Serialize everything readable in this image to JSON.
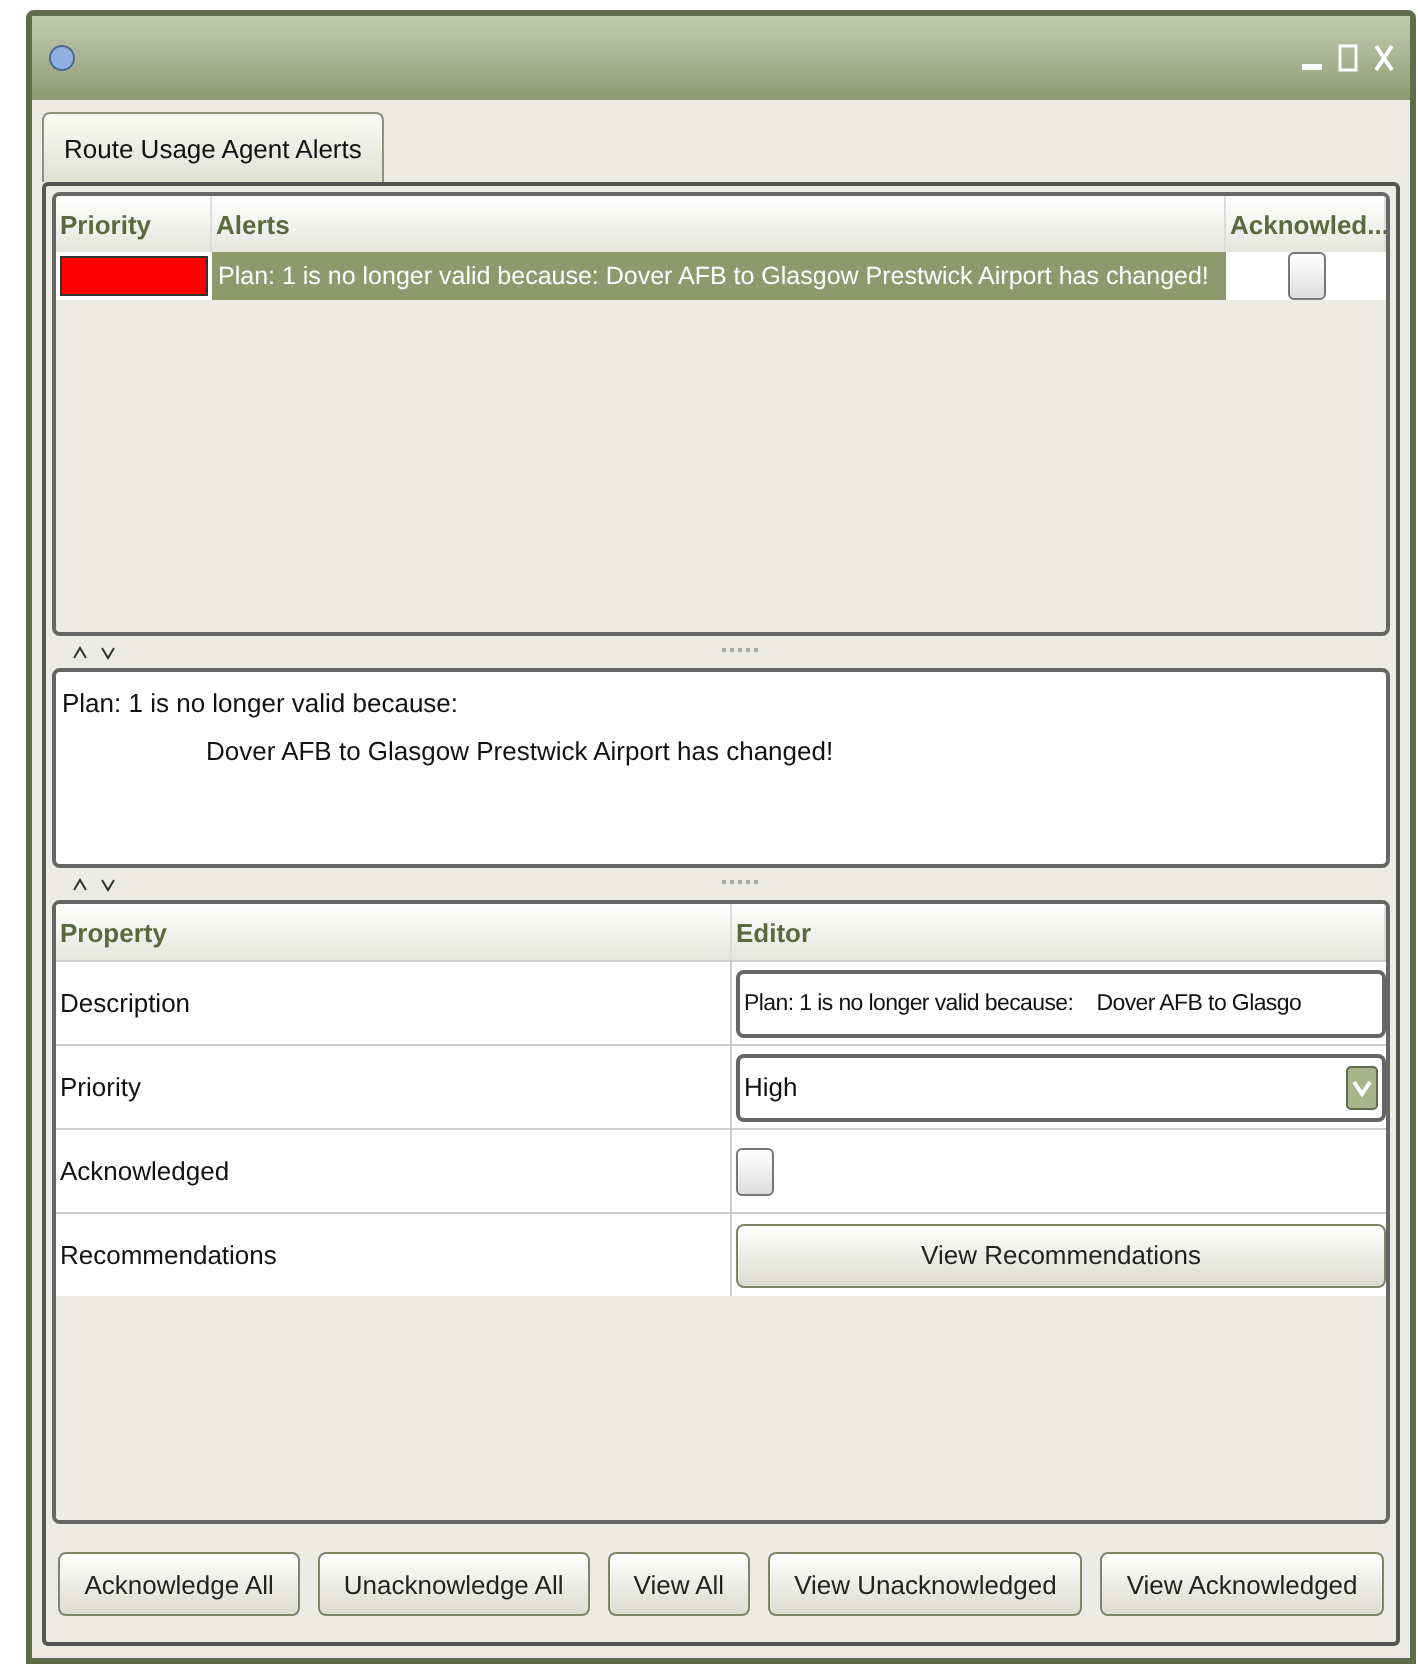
{
  "tabs": [
    {
      "label": "Route Usage Agent Alerts",
      "selected": true
    }
  ],
  "alerts": {
    "columns": [
      "Priority",
      "Alerts",
      "Acknowled..."
    ],
    "rows": [
      {
        "color": "#ff0000",
        "text": "Plan: 1 is no longer valid because: Dover AFB to Glasgow Prestwick Airport has changed!",
        "acknowledged": false,
        "selected": true
      }
    ]
  },
  "detail": {
    "lines": [
      "Plan: 1 is no longer valid because:",
      "Dover AFB to Glasgow Prestwick Airport has changed!"
    ]
  },
  "properties": {
    "columns": [
      "Property",
      "Editor"
    ],
    "rows": [
      {
        "name": "Description",
        "kind": "text",
        "value": "Plan: 1 is no longer valid because:    Dover AFB to Glasgo"
      },
      {
        "name": "Priority",
        "kind": "select",
        "value": "High"
      },
      {
        "name": "Acknowledged",
        "kind": "checkbox",
        "checked": false
      },
      {
        "name": "Recommendations",
        "kind": "button",
        "value": "View Recommendations"
      }
    ]
  },
  "buttons": [
    "Acknowledge All",
    "Unacknowledge All",
    "View All",
    "View Unacknowledged",
    "View Acknowledged"
  ]
}
